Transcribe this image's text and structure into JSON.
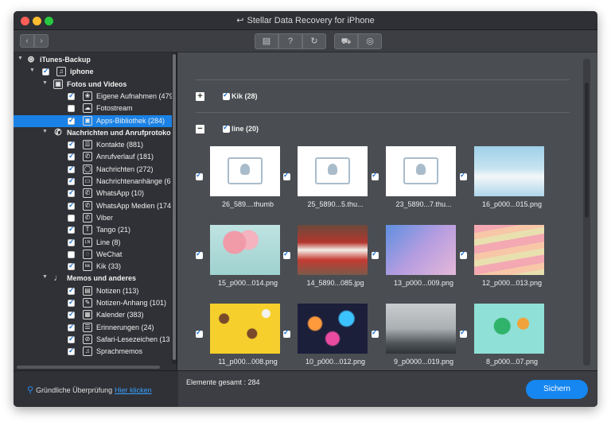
{
  "window": {
    "title": "Stellar Data Recovery for iPhone",
    "title_icon": "back-arrow-icon"
  },
  "toolbar": {
    "back": "‹",
    "forward": "›",
    "buttons": [
      {
        "name": "save-list-icon",
        "glyph": "▤"
      },
      {
        "name": "help-icon",
        "glyph": "?"
      },
      {
        "name": "refresh-icon",
        "glyph": "↻"
      },
      {
        "name": "cart-icon",
        "glyph": "🛒"
      },
      {
        "name": "account-icon",
        "glyph": "◎"
      }
    ]
  },
  "sidebar": {
    "root": {
      "label": "iTunes-Backup",
      "icon": "music-note-icon"
    },
    "device": {
      "label": "iphone",
      "icon": "music-note-icon"
    },
    "groups": [
      {
        "label": "Fotos und Videos",
        "icon": "photos-icon"
      },
      {
        "label": "Nachrichten und Anrufprotoko",
        "icon": "phone-chat-icon"
      },
      {
        "label": "Memos und anderes",
        "icon": "microphone-icon"
      }
    ],
    "items": [
      {
        "label": "Eigene Aufnahmen (479",
        "checked": true,
        "icon": "flower-icon",
        "glyph": "❀"
      },
      {
        "label": "Fotostream",
        "checked": false,
        "icon": "cloud-icon",
        "glyph": "☁"
      },
      {
        "label": "Apps-Bibliothek (284)",
        "checked": true,
        "icon": "apps-icon",
        "glyph": "▣",
        "selected": true
      },
      {
        "label": "Kontakte (881)",
        "checked": true,
        "icon": "contacts-icon",
        "glyph": "☰"
      },
      {
        "label": "Anrufverlauf (181)",
        "checked": true,
        "icon": "phone-icon",
        "glyph": "✆"
      },
      {
        "label": "Nachrichten (272)",
        "checked": true,
        "icon": "message-icon",
        "glyph": "◯"
      },
      {
        "label": "Nachrichtenanhänge (6",
        "checked": true,
        "icon": "attachment-icon",
        "glyph": "▭"
      },
      {
        "label": "WhatsApp (10)",
        "checked": true,
        "icon": "whatsapp-icon",
        "glyph": "✆"
      },
      {
        "label": "WhatsApp Medien (174",
        "checked": true,
        "icon": "whatsapp-media-icon",
        "glyph": "✆"
      },
      {
        "label": "Viber",
        "checked": false,
        "icon": "viber-icon",
        "glyph": "✆"
      },
      {
        "label": "Tango (21)",
        "checked": true,
        "icon": "tango-icon",
        "glyph": "T"
      },
      {
        "label": "Line (8)",
        "checked": true,
        "icon": "line-icon",
        "glyph": "LN"
      },
      {
        "label": "WeChat",
        "checked": false,
        "icon": "wechat-icon",
        "glyph": "◌"
      },
      {
        "label": "Kik (33)",
        "checked": true,
        "icon": "kik-icon",
        "glyph": "kik"
      },
      {
        "label": "Notizen (113)",
        "checked": true,
        "icon": "notes-icon",
        "glyph": "▤"
      },
      {
        "label": "Notizen-Anhang (101)",
        "checked": true,
        "icon": "note-attachment-icon",
        "glyph": "✎"
      },
      {
        "label": "Kalender (383)",
        "checked": true,
        "icon": "calendar-icon",
        "glyph": "▦"
      },
      {
        "label": "Erinnerungen (24)",
        "checked": true,
        "icon": "reminders-icon",
        "glyph": "☰"
      },
      {
        "label": "Safari-Lesezeichen (13",
        "checked": true,
        "icon": "safari-icon",
        "glyph": "⊘"
      },
      {
        "label": "Sprachmemos",
        "checked": true,
        "icon": "voice-memo-icon",
        "glyph": "♫"
      }
    ]
  },
  "main": {
    "groups": [
      {
        "label": "Kik (28)",
        "expander": "+"
      },
      {
        "label": "line (20)",
        "expander": "−"
      }
    ],
    "files": [
      {
        "name": "26_589....thumb"
      },
      {
        "name": "25_5890...5.thu..."
      },
      {
        "name": "23_5890...7.thu..."
      },
      {
        "name": "16_p000...015.png"
      },
      {
        "name": "15_p000...014.png"
      },
      {
        "name": "14_5890...085.jpg"
      },
      {
        "name": "13_p000...009.png"
      },
      {
        "name": "12_p000...013.png"
      },
      {
        "name": "11_p000...008.png"
      },
      {
        "name": "10_p000...012.png"
      },
      {
        "name": "9_p0000...019.png"
      },
      {
        "name": "8_p000...07.png"
      }
    ]
  },
  "footer": {
    "deep_scan_label": "Gründliche Überprüfung",
    "deep_scan_link": "Hier klicken",
    "total_label": "Elemente gesamt : 284",
    "save_label": "Sichern"
  },
  "colors": {
    "accent": "#1686f0",
    "selection": "#1a82e6",
    "link": "#3aa0ff"
  }
}
